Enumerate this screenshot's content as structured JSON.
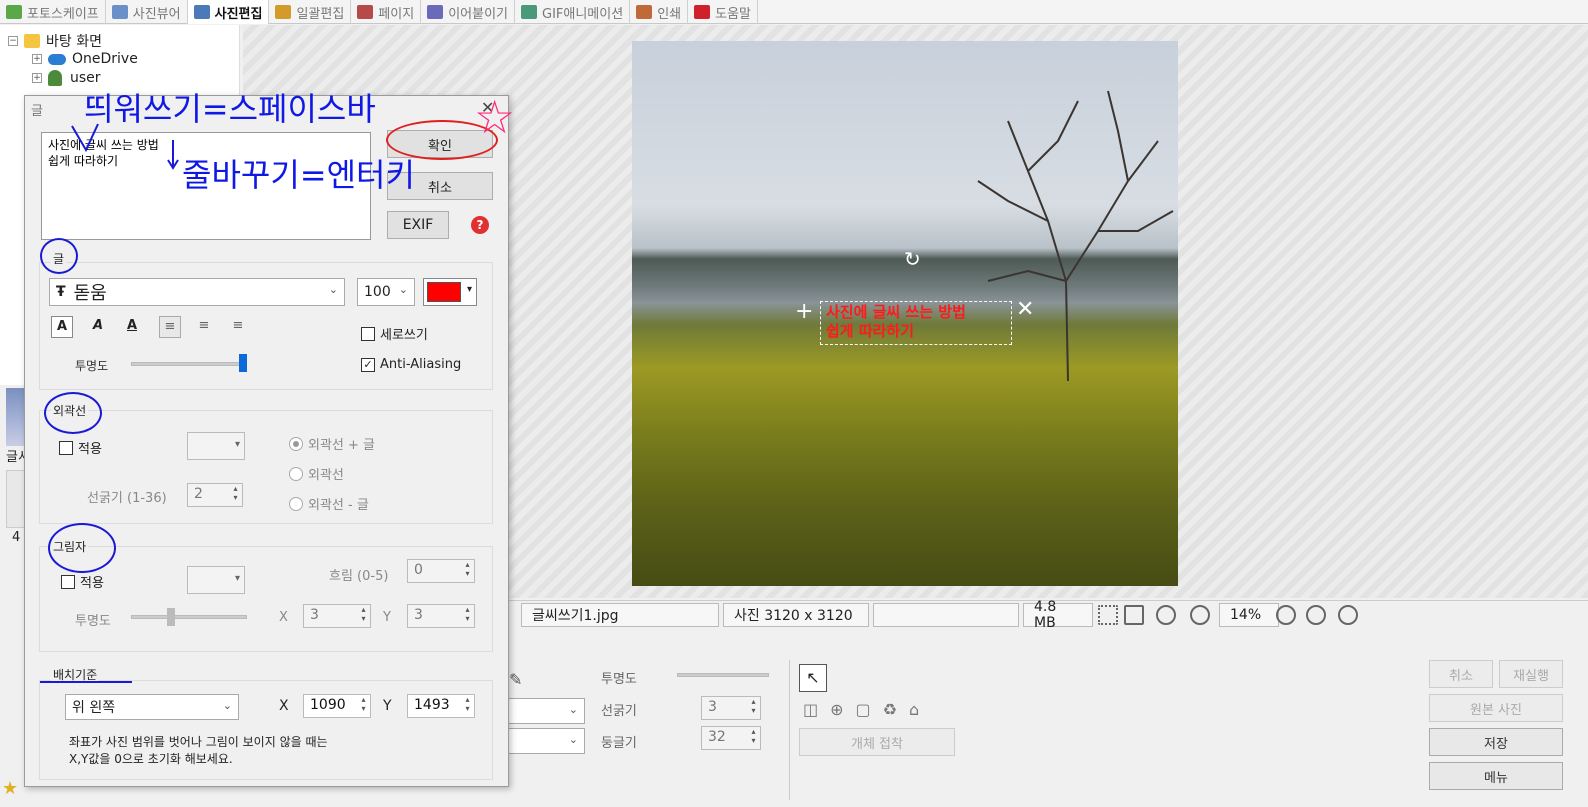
{
  "tabs": [
    {
      "label": "포토스케이프",
      "icon": "photoscape-icon",
      "color": "#5ba84a",
      "active": false
    },
    {
      "label": "사진뷰어",
      "icon": "viewer-icon",
      "color": "#6a8fc9",
      "active": false
    },
    {
      "label": "사진편집",
      "icon": "editor-icon",
      "color": "#4a7ab8",
      "active": true
    },
    {
      "label": "일괄편집",
      "icon": "batch-icon",
      "color": "#d49b2a",
      "active": false
    },
    {
      "label": "페이지",
      "icon": "page-icon",
      "color": "#b64a4a",
      "active": false
    },
    {
      "label": "이어붙이기",
      "icon": "combine-icon",
      "color": "#6a6ab8",
      "active": false
    },
    {
      "label": "GIF애니메이션",
      "icon": "gif-icon",
      "color": "#4a9a7a",
      "active": false
    },
    {
      "label": "인쇄",
      "icon": "print-icon",
      "color": "#c06a3a",
      "active": false
    },
    {
      "label": "도움말",
      "icon": "help-icon",
      "color": "#d0202a",
      "active": false
    }
  ],
  "tree": {
    "items": [
      "바탕 화면",
      "OneDrive",
      "user"
    ]
  },
  "dialog": {
    "title": "글",
    "text_value": "사진에 글씨 쓰는 방법\n쉽게 따라하기",
    "confirm": "확인",
    "cancel": "취소",
    "exif": "EXIF",
    "text_group": "글",
    "font": "돋움",
    "font_size": "100",
    "font_color": "#ff0000",
    "vertical": "세로쓰기",
    "antialias": "Anti-Aliasing",
    "opacity": "투명도",
    "outline_group": "외곽선",
    "apply": "적용",
    "outline_opt1": "외곽선 + 글",
    "outline_opt2": "외곽선",
    "outline_opt3": "외곽선 - 글",
    "thickness_label": "선굵기 (1-36)",
    "thickness": "2",
    "shadow_group": "그림자",
    "blur_label": "흐림 (0-5)",
    "blur": "0",
    "shadow_x": "3",
    "shadow_y": "3",
    "x_label": "X",
    "y_label": "Y",
    "layout_group": "배치기준",
    "anchor": "위 왼쪽",
    "pos_x": "1090",
    "pos_y": "1493",
    "hint": "좌표가 사진 범위를 벗어나 그림이 보이지 않을 때는\nX,Y값을 0으로 초기화 해보세요."
  },
  "annotations": {
    "space": "띄워쓰기=스페이스바",
    "enter": "줄바꾸기=엔터키"
  },
  "photo_text": {
    "line1": "사진에 글씨 쓰는 방법",
    "line2": "쉽게 따라하기"
  },
  "status": {
    "filename": "글씨쓰기1.jpg",
    "size": "사진 3120 x 3120",
    "filesize": "4.8 MB",
    "zoom": "14%"
  },
  "bottom": {
    "opacity": "투명도",
    "thickness": "선굵기",
    "thickness_val": "3",
    "roundness": "둥글기",
    "roundness_val": "32",
    "attach": "개체 접착",
    "cancel": "취소",
    "redo": "재실행",
    "original": "원본 사진",
    "save": "저장",
    "menu": "메뉴"
  },
  "left_strip": {
    "label1": "글서",
    "label2": "4"
  }
}
